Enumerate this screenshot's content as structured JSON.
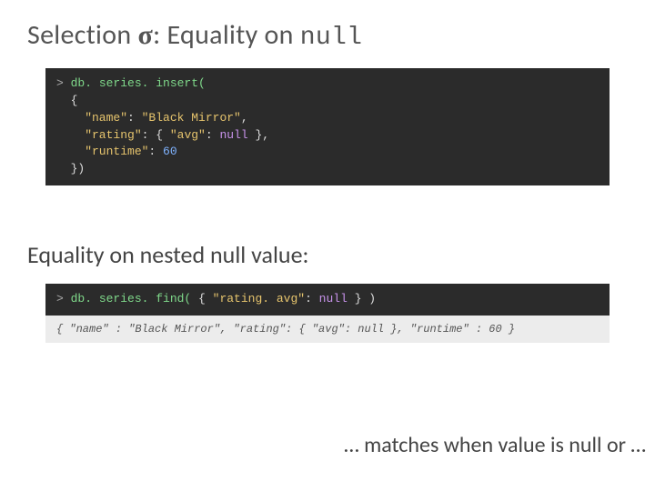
{
  "title": {
    "prefix": "Selection ",
    "sigma": "σ",
    "mid": ": Equality on ",
    "mono": "null"
  },
  "code1": {
    "prompt": "> ",
    "l1_call": "db. series. insert(",
    "l2": "  {",
    "l3_k": "    \"name\"",
    "l3_sep": ": ",
    "l3_v": "\"Black Mirror\"",
    "l3_end": ",",
    "l4_k": "    \"rating\"",
    "l4_sep": ": { ",
    "l4_k2": "\"avg\"",
    "l4_sep2": ": ",
    "l4_null": "null",
    "l4_end": " },",
    "l5_k": "    \"runtime\"",
    "l5_sep": ": ",
    "l5_v": "60",
    "l6": "  })"
  },
  "subhead": "Equality on nested null value:",
  "code2": {
    "prompt": "> ",
    "call": "db. series. find(",
    "sep1": " { ",
    "key": "\"rating. avg\"",
    "sep2": ": ",
    "null": "null",
    "end": " } )"
  },
  "result": "{ \"name\" : \"Black Mirror\", \"rating\": { \"avg\": null }, \"runtime\" : 60 }",
  "footnote": "… matches when value is null or …"
}
